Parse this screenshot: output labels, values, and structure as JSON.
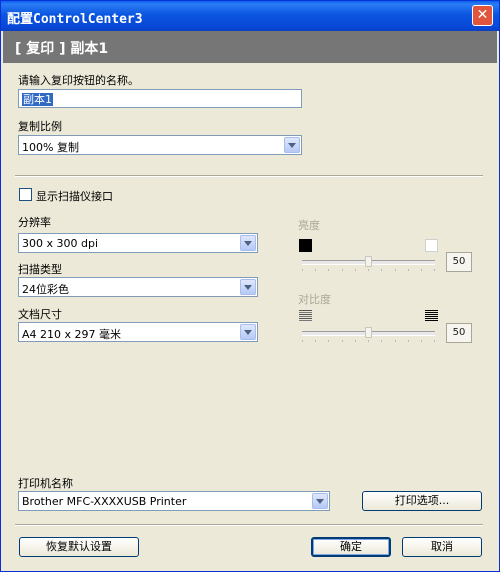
{
  "window": {
    "title": "配置ControlCenter3",
    "close_glyph": "✕"
  },
  "header": {
    "text": "[ 复印 ]  副本1"
  },
  "button_name": {
    "label": "请输入复印按钮的名称。",
    "value": "副本1"
  },
  "copy_ratio": {
    "label": "复制比例",
    "selected": "100% 复制"
  },
  "scanner_interface": {
    "label": "显示扫描仪接口",
    "checked": false
  },
  "resolution": {
    "label": "分辨率",
    "selected": "300 x 300 dpi"
  },
  "scan_type": {
    "label": "扫描类型",
    "selected": "24位彩色"
  },
  "doc_size": {
    "label": "文档尺寸",
    "selected": "A4 210 x 297 毫米"
  },
  "brightness": {
    "label": "亮度",
    "value": "50",
    "enabled": false
  },
  "contrast": {
    "label": "对比度",
    "value": "50",
    "enabled": false
  },
  "printer": {
    "label": "打印机名称",
    "selected": "Brother MFC-XXXXUSB Printer",
    "options_button": "打印选项..."
  },
  "footer": {
    "reset": "恢复默认设置",
    "ok": "确定",
    "cancel": "取消"
  },
  "colors": {
    "titlebar": "#0a4fdf",
    "header_band": "#767676",
    "dialog_bg": "#ece9d8",
    "selection": "#316ac5"
  },
  "icons": {
    "close": "close-icon",
    "dropdown": "chevron-down-icon",
    "brightness_low": "black-square-icon",
    "brightness_high": "white-square-icon",
    "contrast_low": "low-contrast-icon",
    "contrast_high": "high-contrast-icon"
  }
}
